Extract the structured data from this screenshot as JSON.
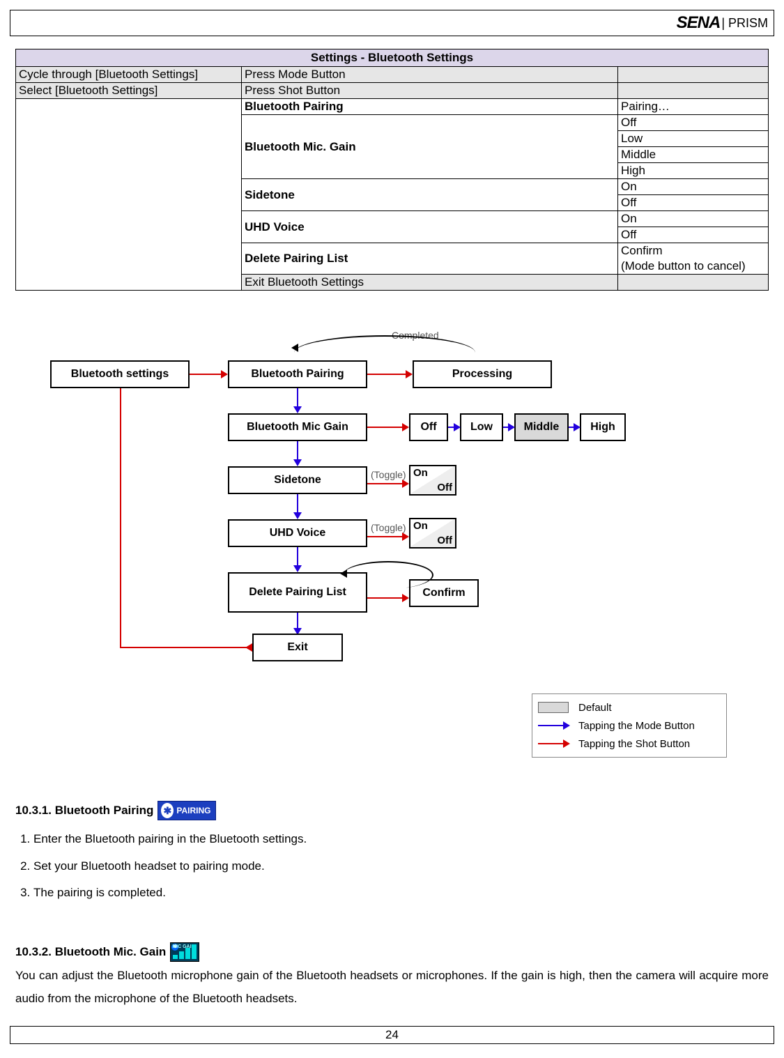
{
  "header": {
    "brand": "SENA",
    "product": "| PRISM"
  },
  "table": {
    "title": "Settings - Bluetooth Settings",
    "rows": {
      "cycle_left": "Cycle through [Bluetooth Settings]",
      "cycle_mid": "Press Mode Button",
      "select_left": "Select [Bluetooth Settings]",
      "select_mid": "Press Shot Button",
      "bt_pairing": "Bluetooth Pairing",
      "pairing_val": "Pairing…",
      "mic_gain": "Bluetooth Mic. Gain",
      "off": "Off",
      "low": "Low",
      "middle": "Middle",
      "high": "High",
      "sidetone": "Sidetone",
      "on": "On",
      "uhd": "UHD Voice",
      "delete": "Delete Pairing List",
      "confirm": "Confirm",
      "cancel_note": "(Mode button to cancel)",
      "exit": "Exit Bluetooth Settings"
    }
  },
  "diagram": {
    "bt_settings": "Bluetooth settings",
    "bt_pairing": "Bluetooth Pairing",
    "processing": "Processing",
    "completed": "Completed",
    "mic_gain": "Bluetooth Mic Gain",
    "off": "Off",
    "low": "Low",
    "middle": "Middle",
    "high": "High",
    "sidetone": "Sidetone",
    "toggle": "(Toggle)",
    "uhd": "UHD Voice",
    "delete": "Delete Pairing List",
    "confirm": "Confirm",
    "exit": "Exit",
    "on": "On",
    "off2": "Off"
  },
  "legend": {
    "default": "Default",
    "mode": "Tapping the Mode Button",
    "shot": "Tapping the Shot Button"
  },
  "section1": {
    "heading": "10.3.1. Bluetooth Pairing",
    "badge": "PAIRING",
    "s1": "Enter the Bluetooth pairing in the Bluetooth settings.",
    "s2": "Set your Bluetooth headset to pairing mode.",
    "s3": "The pairing is completed."
  },
  "section2": {
    "heading": "10.3.2. Bluetooth Mic. Gain",
    "badge": "MIC GAIN",
    "body": "You can adjust the Bluetooth microphone gain of the Bluetooth headsets or microphones. If the gain is high, then the camera will acquire more audio from the microphone of the Bluetooth headsets."
  },
  "footer": {
    "page": "24"
  }
}
